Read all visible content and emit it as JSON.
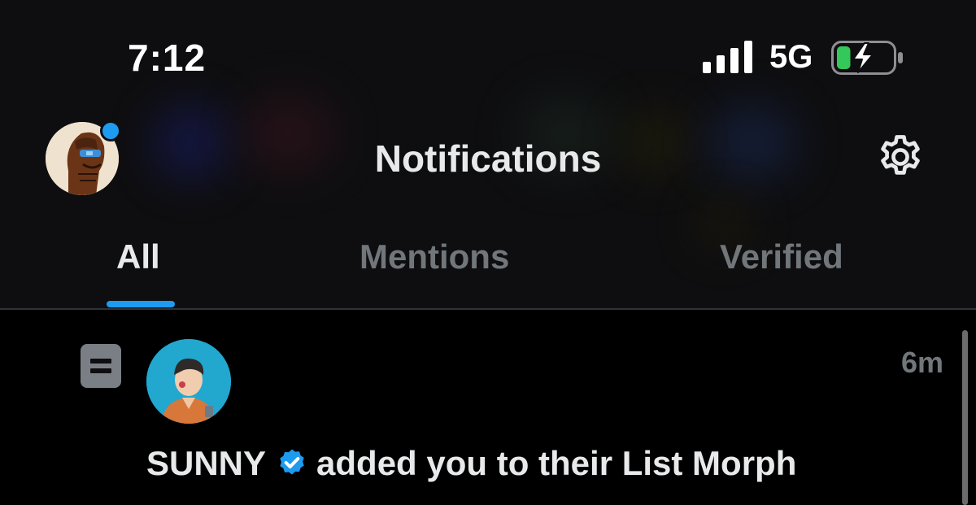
{
  "status_bar": {
    "time": "7:12",
    "network": "5G",
    "battery_icon": "battery-charging-icon",
    "battery_level_fraction": 0.25,
    "battery_color": "#34c759"
  },
  "header": {
    "title": "Notifications",
    "settings_icon": "gear-icon",
    "avatar_indicator_color": "#1d9bf0"
  },
  "tabs": [
    {
      "label": "All",
      "active": true
    },
    {
      "label": "Mentions",
      "active": false
    },
    {
      "label": "Verified",
      "active": false
    }
  ],
  "notifications": [
    {
      "type_icon": "list-icon",
      "user": "SUNNY",
      "verified": true,
      "message": "added you to their List Morph",
      "time": "6m"
    }
  ],
  "colors": {
    "accent": "#1d9bf0",
    "background": "#000000",
    "header_background": "#0e0e10",
    "text_primary": "#e7e9ea",
    "text_secondary": "#71767b"
  }
}
